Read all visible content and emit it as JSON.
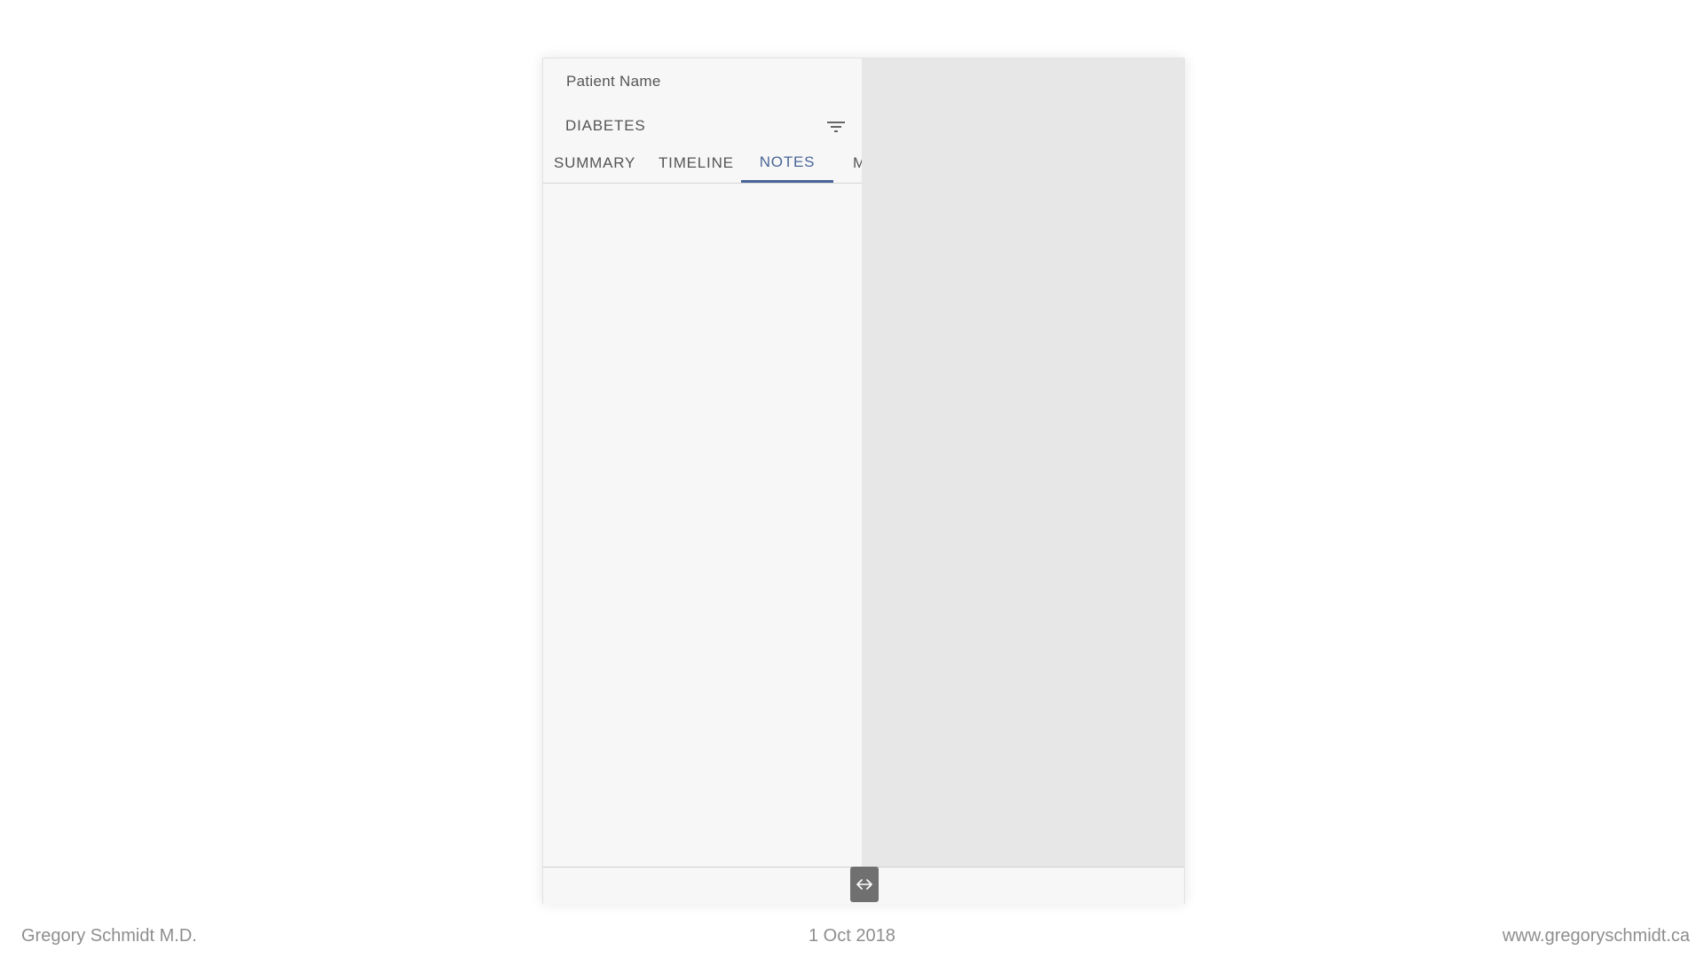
{
  "app": {
    "patient_label": "Patient Name",
    "condition": "DIABETES"
  },
  "tabs": [
    {
      "label": "SUMMARY",
      "active": false
    },
    {
      "label": "TIMELINE",
      "active": false
    },
    {
      "label": "NOTES",
      "active": true
    },
    {
      "label": "M",
      "active": false
    }
  ],
  "icons": {
    "filter": "filter-icon",
    "resize": "left-right-arrow-icon"
  },
  "colors": {
    "accent": "#4a6597",
    "pane_left": "#f7f7f7",
    "pane_right": "#e7e7e7",
    "handle": "#707070"
  },
  "slide_footer": {
    "author": "Gregory Schmidt M.D.",
    "date": "1 Oct 2018",
    "website": "www.gregoryschmidt.ca"
  }
}
